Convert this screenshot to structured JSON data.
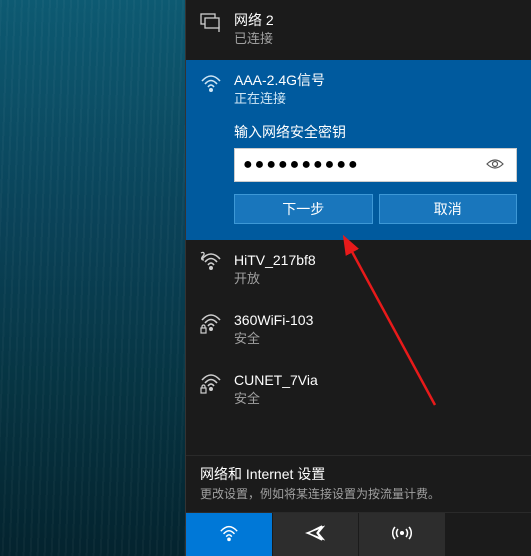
{
  "current_network": {
    "name": "网络 2",
    "status": "已连接"
  },
  "active_network": {
    "name": "AAA-2.4G信号",
    "status": "正在连接",
    "form_label": "输入网络安全密钥",
    "password_masked": "●●●●●●●●●●",
    "next_button": "下一步",
    "cancel_button": "取消"
  },
  "networks": [
    {
      "name": "HiTV_217bf8",
      "status": "开放",
      "secure": false
    },
    {
      "name": "360WiFi-103",
      "status": "安全",
      "secure": true
    },
    {
      "name": "CUNET_7Via",
      "status": "安全",
      "secure": true
    }
  ],
  "settings": {
    "title": "网络和 Internet 设置",
    "subtitle": "更改设置，例如将某连接设置为按流量计费。"
  },
  "bottom_tabs": {
    "wifi": "wifi",
    "airplane": "airplane",
    "hotspot": "hotspot"
  }
}
